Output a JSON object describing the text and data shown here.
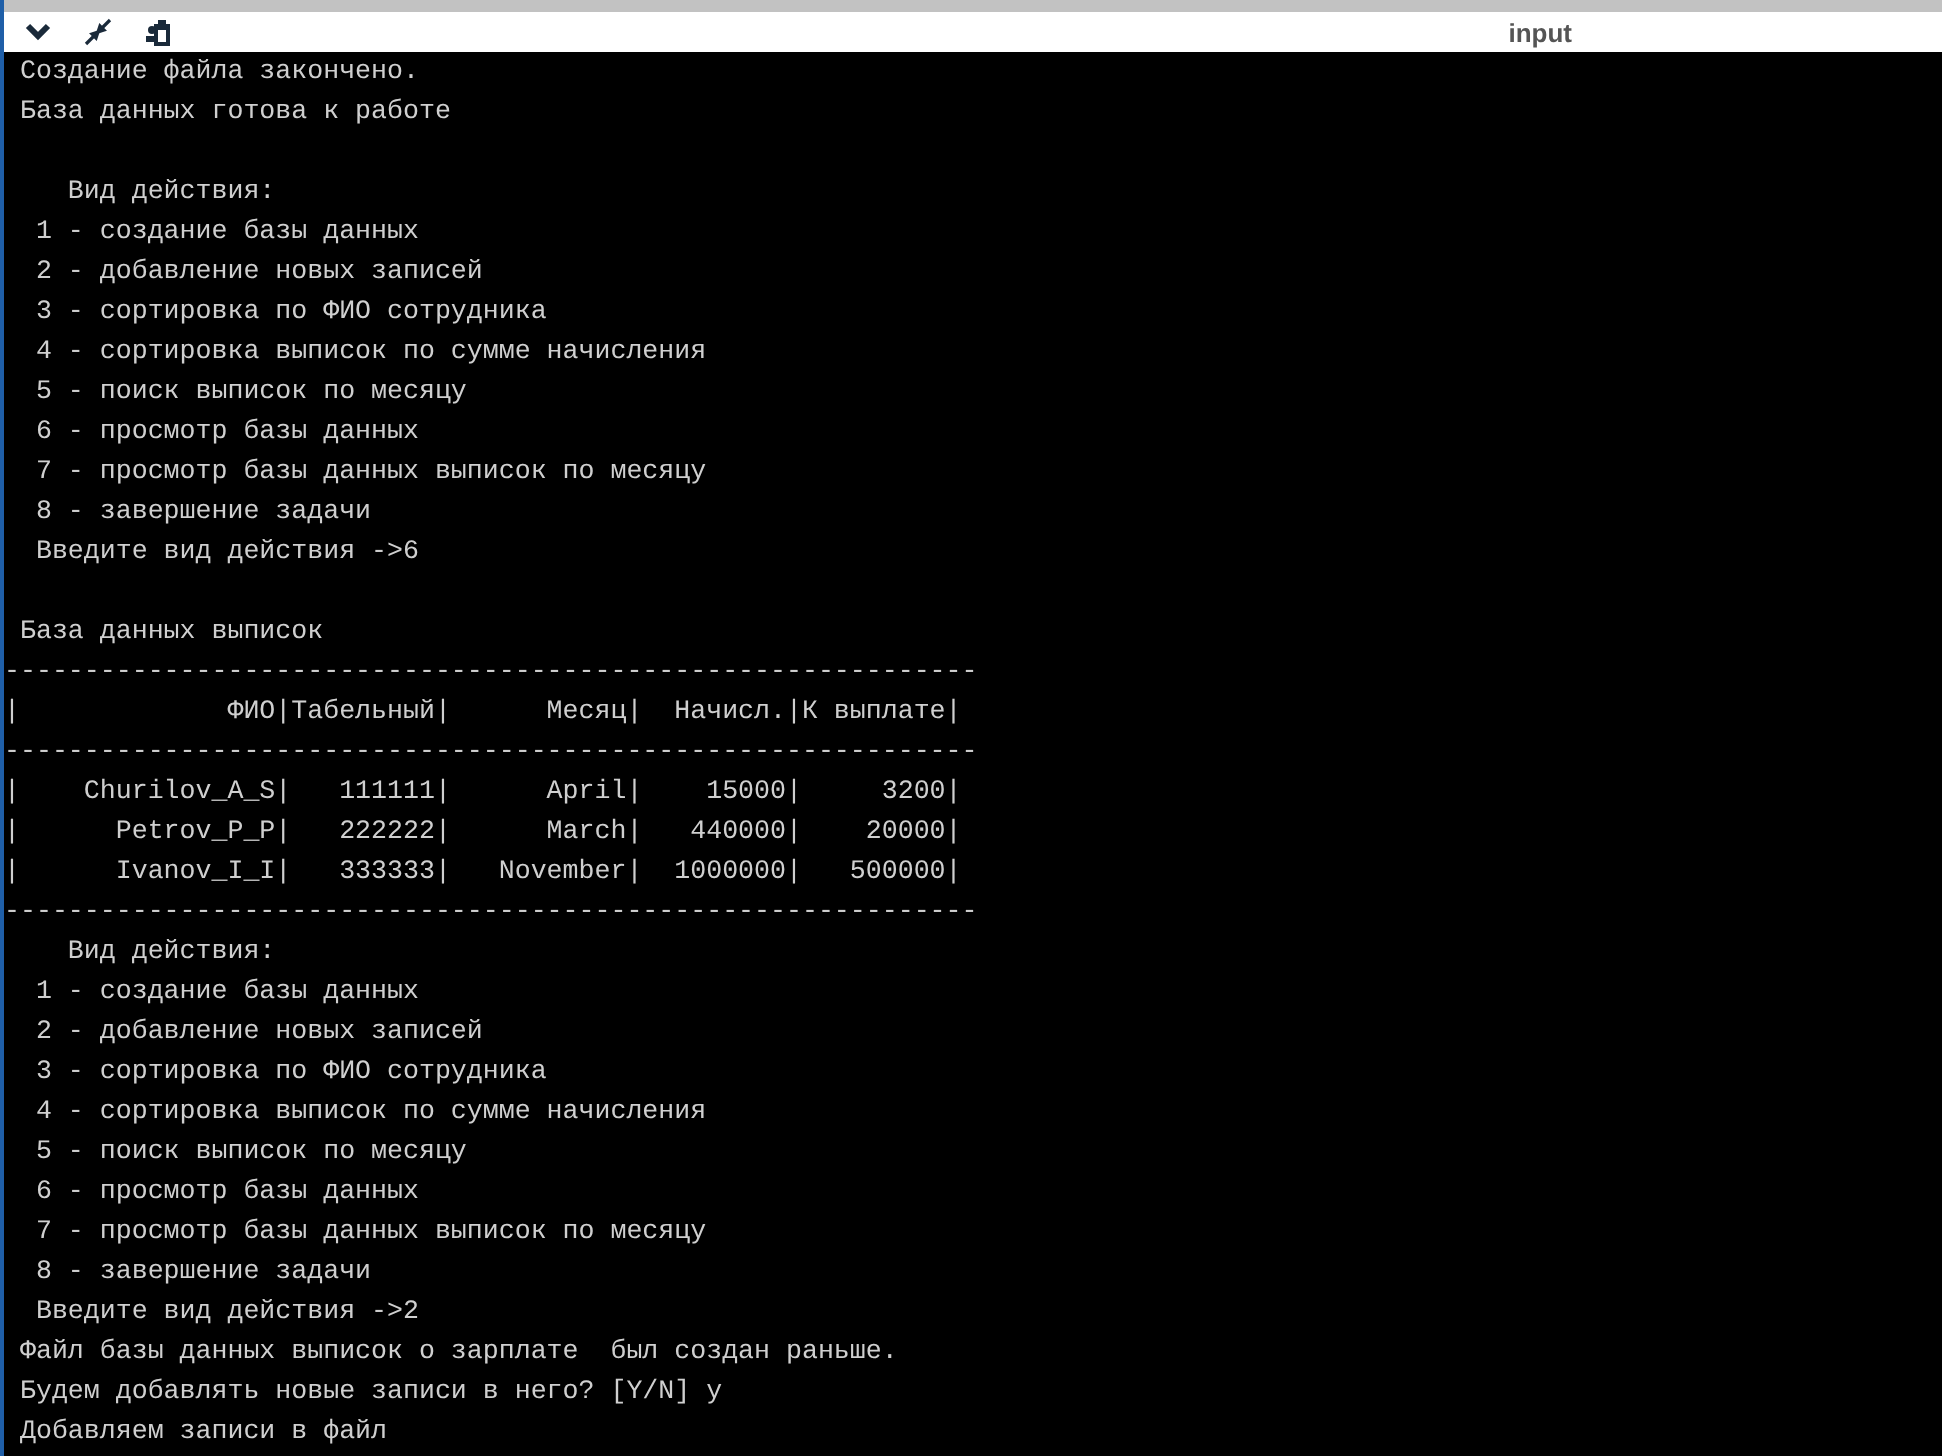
{
  "window": {
    "title": "input"
  },
  "console": {
    "lines": [
      {
        "kind": "text",
        "text": " Создание файла закончено."
      },
      {
        "kind": "text",
        "text": " База данных готова к работе"
      },
      {
        "kind": "blank"
      },
      {
        "kind": "text",
        "text": "    Вид действия:"
      },
      {
        "kind": "text",
        "text": "  1 - создание базы данных"
      },
      {
        "kind": "text",
        "text": "  2 - добавление новых записей"
      },
      {
        "kind": "text",
        "text": "  3 - сортировка по ФИО сотрудника"
      },
      {
        "kind": "text",
        "text": "  4 - сортировка выписок по сумме начисления"
      },
      {
        "kind": "text",
        "text": "  5 - поиск выписок по месяцу"
      },
      {
        "kind": "text",
        "text": "  6 - просмотр базы данных"
      },
      {
        "kind": "text",
        "text": "  7 - просмотр базы данных выписок по месяцу"
      },
      {
        "kind": "text",
        "text": "  8 - завершение задачи"
      },
      {
        "kind": "text",
        "text": "  Введите вид действия ->6"
      },
      {
        "kind": "blank"
      },
      {
        "kind": "text",
        "text": " База данных выписок"
      },
      {
        "kind": "text",
        "text": "-------------------------------------------------------------"
      },
      {
        "kind": "text",
        "text": "|             ФИО|Табельный|      Месяц|  Начисл.|К выплате|"
      },
      {
        "kind": "text",
        "text": "-------------------------------------------------------------"
      },
      {
        "kind": "text",
        "text": "|    Churilov_A_S|   111111|      April|    15000|     3200|"
      },
      {
        "kind": "text",
        "text": "|      Petrov_P_P|   222222|      March|   440000|    20000|"
      },
      {
        "kind": "text",
        "text": "|      Ivanov_I_I|   333333|   November|  1000000|   500000|"
      },
      {
        "kind": "text",
        "text": "-------------------------------------------------------------"
      },
      {
        "kind": "text",
        "text": "    Вид действия:"
      },
      {
        "kind": "text",
        "text": "  1 - создание базы данных"
      },
      {
        "kind": "text",
        "text": "  2 - добавление новых записей"
      },
      {
        "kind": "text",
        "text": "  3 - сортировка по ФИО сотрудника"
      },
      {
        "kind": "text",
        "text": "  4 - сортировка выписок по сумме начисления"
      },
      {
        "kind": "text",
        "text": "  5 - поиск выписок по месяцу"
      },
      {
        "kind": "text",
        "text": "  6 - просмотр базы данных"
      },
      {
        "kind": "text",
        "text": "  7 - просмотр базы данных выписок по месяцу"
      },
      {
        "kind": "text",
        "text": "  8 - завершение задачи"
      },
      {
        "kind": "text",
        "text": "  Введите вид действия ->2"
      },
      {
        "kind": "text",
        "text": " Файл базы данных выписок о зарплате  был создан раньше."
      },
      {
        "kind": "text",
        "text": " Будем добавлять новые записи в него? [Y/N] y"
      },
      {
        "kind": "text",
        "text": " Добавляем записи в файл"
      }
    ]
  }
}
